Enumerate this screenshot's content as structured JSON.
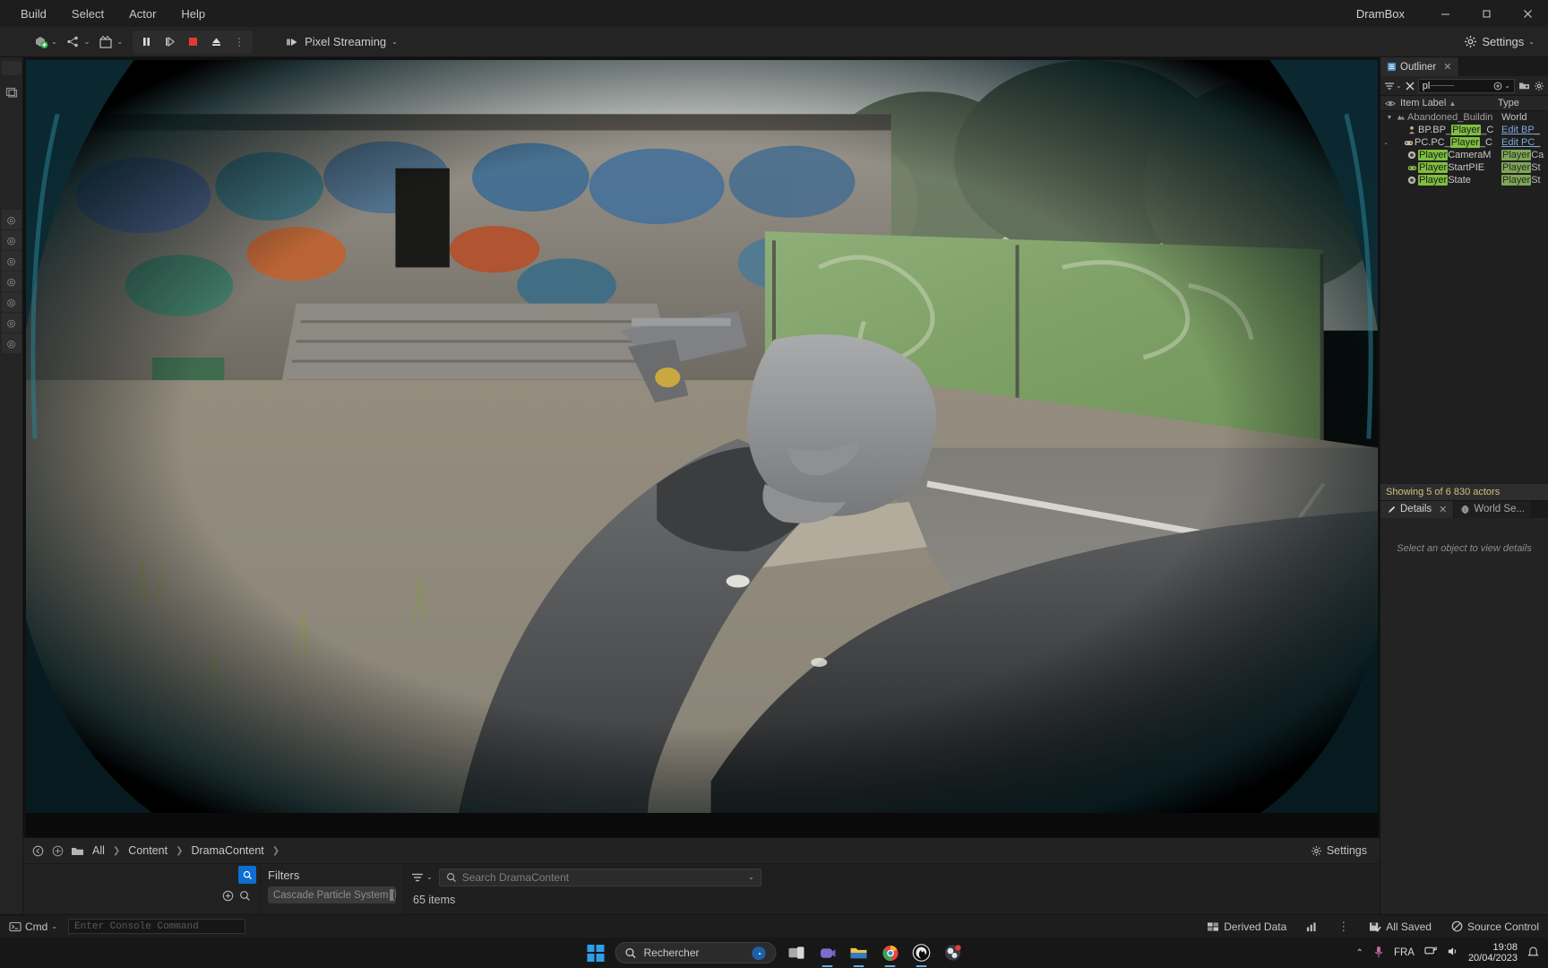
{
  "titlebar": {
    "menu": [
      "Build",
      "Select",
      "Actor",
      "Help"
    ],
    "window_title": "DramBox",
    "minimize": "—",
    "maximize": "❐",
    "close": "✕"
  },
  "toolbar": {
    "add_actor_label": "add-actor",
    "blueprint_label": "blueprints",
    "cinematics_label": "cinematics",
    "pause": "❙❙",
    "step": "▐▶",
    "stop": "■",
    "eject": "⏏",
    "more": "⋮",
    "pixel_streaming": "Pixel Streaming",
    "settings": "Settings",
    "caret": "⌄"
  },
  "rail": {
    "help_icon": "?",
    "items": [
      "?",
      "?",
      "?",
      "?",
      "?",
      "?",
      "?"
    ]
  },
  "outliner": {
    "tab_label": "Outliner",
    "close": "✕",
    "search_value": "pl",
    "filter_icon": "filter-icon",
    "clear_icon": "✕",
    "add_icon": "⊕",
    "folder_icon": "folder-new-icon",
    "settings_icon": "gear-icon",
    "columns": {
      "label": "Item Label",
      "sort": "▲",
      "type": "Type"
    },
    "rows": [
      {
        "indent": 0,
        "expander": "▼",
        "icon": "world-icon",
        "label": "Abandoned_Buildin",
        "type": "World",
        "highlight": ""
      },
      {
        "indent": 1,
        "expander": "",
        "icon": "pawn-icon",
        "label_pre": "BP.BP_",
        "label_hl": "Player",
        "label_post": "_C",
        "type": "Edit BP_",
        "type_link": true
      },
      {
        "indent": 1,
        "expander": "",
        "icon": "controller-icon",
        "label_pre": "PC.PC_",
        "label_hl": "Player",
        "label_post": "_C",
        "type": "Edit PC_",
        "type_link": true
      },
      {
        "indent": 1,
        "expander": "",
        "icon": "camera-icon",
        "label_pre": "",
        "label_hl": "Player",
        "label_post": "CameraM",
        "type_hl": "Player",
        "type_post": "Ca"
      },
      {
        "indent": 1,
        "expander": "",
        "icon": "start-icon",
        "label_pre": "",
        "label_hl": "Player",
        "label_post": "StartPIE",
        "type_hl": "Player",
        "type_post": "St"
      },
      {
        "indent": 1,
        "expander": "",
        "icon": "state-icon",
        "label_pre": "",
        "label_hl": "Player",
        "label_post": "State",
        "type_hl": "Player",
        "type_post": "St"
      }
    ],
    "status": "Showing 5 of 6 830 actors"
  },
  "details": {
    "tab_label": "Details",
    "close": "✕",
    "world_tab_label": "World Se...",
    "empty_hint": "Select an object to view details"
  },
  "content_browser": {
    "breadcrumb": [
      "All",
      "Content",
      "DramaContent"
    ],
    "separator": "❯",
    "settings_label": "Settings",
    "filters_title": "Filters",
    "filter_pill": "Cascade Particle System (L.",
    "search_placeholder": "Search DramaContent",
    "items_count": "65 items",
    "back_icon": "◀",
    "forward_icon": "▶",
    "folder_icon": "folder-icon",
    "search_icon": "⌕"
  },
  "statusbar": {
    "cmd_label": "Cmd",
    "console_placeholder": "Enter Console Command",
    "derived_data": "Derived Data",
    "all_saved": "All Saved",
    "source_control": "Source Control"
  },
  "taskbar": {
    "search_placeholder": "Rechercher",
    "apps": [
      "task-view",
      "teams",
      "file-explorer",
      "chrome",
      "unreal-engine",
      "obs-studio"
    ],
    "tray_chevron": "⌃",
    "mic": "mic-icon",
    "language": "FRA",
    "network": "network-icon",
    "volume": "volume-icon",
    "time": "19:08",
    "date": "20/04/2023",
    "notifications": "notification-icon"
  },
  "colors": {
    "accent_blue": "#0d6fd1",
    "highlight_green": "#7fbf3f",
    "status_yellow": "#cfc07a",
    "record_red": "#e23a2e",
    "link_blue": "#7fa8d8"
  }
}
